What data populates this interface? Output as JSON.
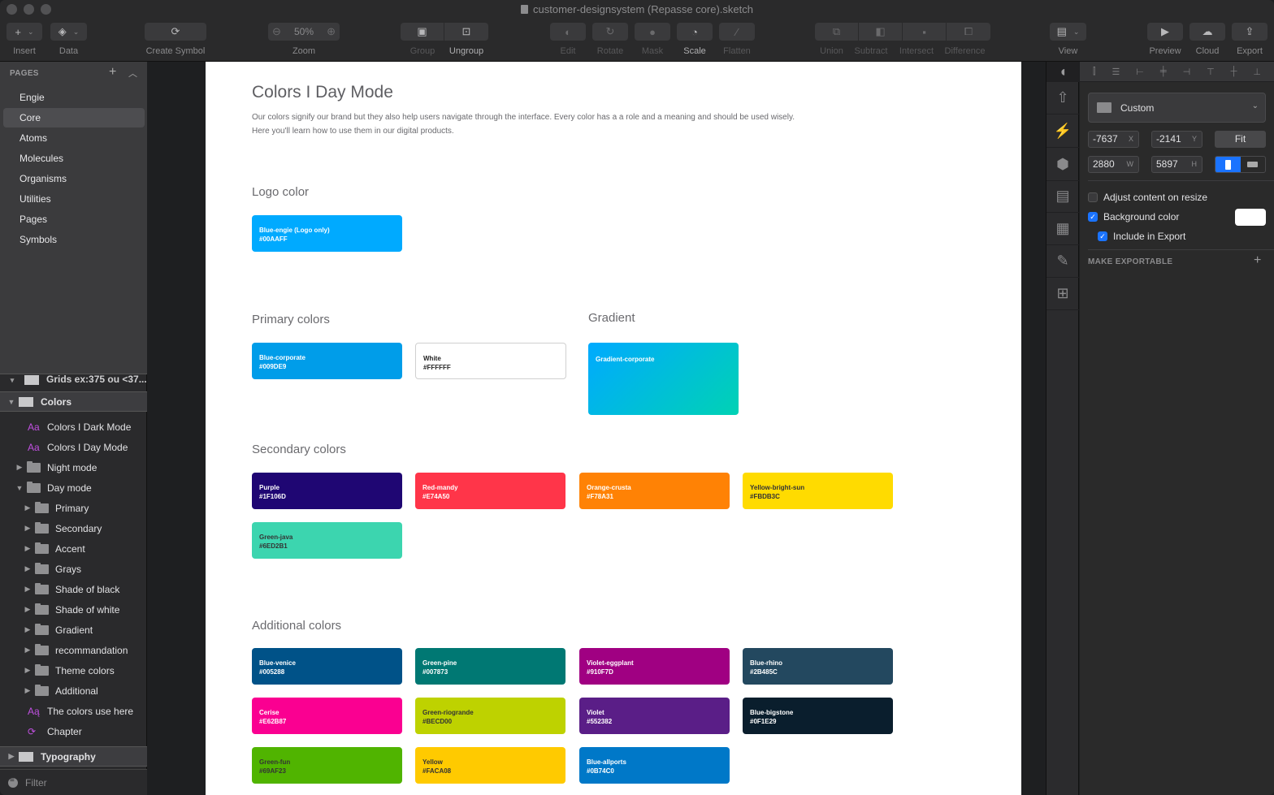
{
  "window": {
    "title": "customer-designsystem (Repasse core).sketch"
  },
  "toolbar": {
    "insert": "Insert",
    "data": "Data",
    "create_symbol": "Create Symbol",
    "zoom_label": "Zoom",
    "zoom_value": "50%",
    "group": "Group",
    "ungroup": "Ungroup",
    "edit": "Edit",
    "rotate": "Rotate",
    "mask": "Mask",
    "scale": "Scale",
    "flatten": "Flatten",
    "union": "Union",
    "subtract": "Subtract",
    "intersect": "Intersect",
    "difference": "Difference",
    "view": "View",
    "preview": "Preview",
    "cloud": "Cloud",
    "export": "Export"
  },
  "pages": {
    "header": "PAGES",
    "items": [
      {
        "label": "Engie",
        "active": false
      },
      {
        "label": "Core",
        "active": true
      },
      {
        "label": "Atoms",
        "active": false
      },
      {
        "label": "Molecules",
        "active": false
      },
      {
        "label": "Organisms",
        "active": false
      },
      {
        "label": "Utilities",
        "active": false
      },
      {
        "label": "Pages",
        "active": false
      },
      {
        "label": "Symbols",
        "active": false
      }
    ]
  },
  "layers": {
    "clipped_row": "Grids ex:375 ou <37...",
    "colors_group": "Colors",
    "items": [
      {
        "label": "Colors I Dark Mode",
        "type": "text-style"
      },
      {
        "label": "Colors I Day Mode",
        "type": "text-style"
      },
      {
        "label": "Night mode",
        "type": "folder",
        "expanded": false
      },
      {
        "label": "Day mode",
        "type": "folder",
        "expanded": true
      },
      {
        "label": "Primary",
        "type": "folder",
        "expanded": false
      },
      {
        "label": "Secondary",
        "type": "folder",
        "expanded": false
      },
      {
        "label": "Accent",
        "type": "folder",
        "expanded": false
      },
      {
        "label": "Grays",
        "type": "folder",
        "expanded": false
      },
      {
        "label": "Shade of black",
        "type": "folder",
        "expanded": false
      },
      {
        "label": "Shade of white",
        "type": "folder",
        "expanded": false
      },
      {
        "label": "Gradient",
        "type": "folder",
        "expanded": false
      },
      {
        "label": "recommandation",
        "type": "folder",
        "expanded": false
      },
      {
        "label": "Theme colors",
        "type": "folder",
        "expanded": false
      },
      {
        "label": "Additional",
        "type": "folder",
        "expanded": false
      },
      {
        "label": "The colors use here",
        "type": "text-override"
      },
      {
        "label": "Chapter",
        "type": "symbol"
      }
    ],
    "typography_group": "Typography",
    "filter": "Filter"
  },
  "document": {
    "title": "Colors I Day Mode",
    "description_line1": "Our colors signify our brand but they also help users navigate through the interface. Every color has a a role and a meaning and should be used wisely.",
    "description_line2": "Here you'll learn how to use them in our digital products.",
    "sections": {
      "logo": "Logo color",
      "primary": "Primary colors",
      "gradient": "Gradient",
      "secondary": "Secondary colors",
      "additional": "Additional colors"
    },
    "logo_colors": [
      {
        "name": "Blue-engie (Logo only)",
        "hex": "#00AAFF",
        "fill": "#00AAFF"
      }
    ],
    "primary_colors": [
      {
        "name": "Blue-corporate",
        "hex": "#009DE9",
        "fill": "#009DE9"
      },
      {
        "name": "White",
        "hex": "#FFFFFF",
        "fill": "#FFFFFF"
      }
    ],
    "gradient_colors": [
      {
        "name": "Gradient-corporate",
        "from": "#00AAFF",
        "to": "#00D2B4"
      }
    ],
    "secondary_colors": [
      {
        "name": "Purple",
        "hex": "#1F106D",
        "fill": "#1F0673"
      },
      {
        "name": "Red-mandy",
        "hex": "#E74A50",
        "fill": "#FF3549"
      },
      {
        "name": "Orange-crusta",
        "hex": "#F78A31",
        "fill": "#FF8205"
      },
      {
        "name": "Yellow-bright-sun",
        "hex": "#FBDB3C",
        "fill": "#FFDB00"
      },
      {
        "name": "Green-java",
        "hex": "#6ED2B1",
        "fill": "#3CD5AF"
      }
    ],
    "additional_colors": [
      {
        "name": "Blue-venice",
        "hex": "#005288",
        "fill": "#005288"
      },
      {
        "name": "Green-pine",
        "hex": "#007873",
        "fill": "#007873"
      },
      {
        "name": "Violet-eggplant",
        "hex": "#910F7D",
        "fill": "#A00082"
      },
      {
        "name": "Blue-rhino",
        "hex": "#2B485C",
        "fill": "#23485F"
      },
      {
        "name": "Cerise",
        "hex": "#E62B87",
        "fill": "#FA0091"
      },
      {
        "name": "Green-riogrande",
        "hex": "#BECD00",
        "fill": "#BED200"
      },
      {
        "name": "Violet",
        "hex": "#552382",
        "fill": "#5A1E87"
      },
      {
        "name": "Blue-bigstone",
        "hex": "#0F1E29",
        "fill": "#0A1E2D"
      },
      {
        "name": "Green-fun",
        "hex": "#69AF23",
        "fill": "#50B400"
      },
      {
        "name": "Yellow",
        "hex": "#FACA08",
        "fill": "#FFCA00"
      },
      {
        "name": "Blue-allports",
        "hex": "#0B74C0",
        "fill": "#0078C8"
      }
    ]
  },
  "inspector": {
    "preset": "Custom",
    "x": "-7637",
    "x_suffix": "X",
    "y": "-2141",
    "y_suffix": "Y",
    "w": "2880",
    "w_suffix": "W",
    "h": "5897",
    "h_suffix": "H",
    "fit": "Fit",
    "orientation": "portrait",
    "adjust_content": {
      "label": "Adjust content on resize",
      "checked": false
    },
    "background_color": {
      "label": "Background color",
      "checked": true,
      "value": "#FFFFFF"
    },
    "include_export": {
      "label": "Include in Export",
      "checked": true
    },
    "make_exportable": "MAKE EXPORTABLE"
  },
  "colors": {
    "accent": "#1A73FF",
    "text_style_icon": "#C050E0"
  }
}
